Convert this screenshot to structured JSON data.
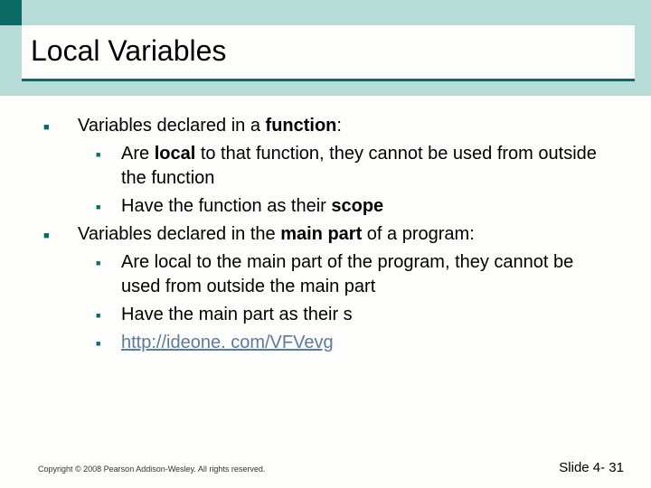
{
  "title": "Local Variables",
  "bullets": {
    "b1_intro": "Variables declared in a ",
    "b1_bold": "function",
    "b1_after": ":",
    "b1_1_a": "Are ",
    "b1_1_bold": "local",
    "b1_1_b": " to that function, they cannot be used from outside the function",
    "b1_2_a": "Have the function as their ",
    "b1_2_bold": "scope",
    "b2_intro": "Variables declared in the ",
    "b2_bold": "main part",
    "b2_after": " of a program:",
    "b2_1": "Are local to the main part of the program, they cannot be used from outside the main part",
    "b2_2": "Have the main part as their s",
    "b2_3_link": "http://ideone. com/VFVevg"
  },
  "footer": {
    "copyright": "Copyright © 2008 Pearson Addison-Wesley. All rights reserved.",
    "slide": "Slide 4- 31"
  }
}
